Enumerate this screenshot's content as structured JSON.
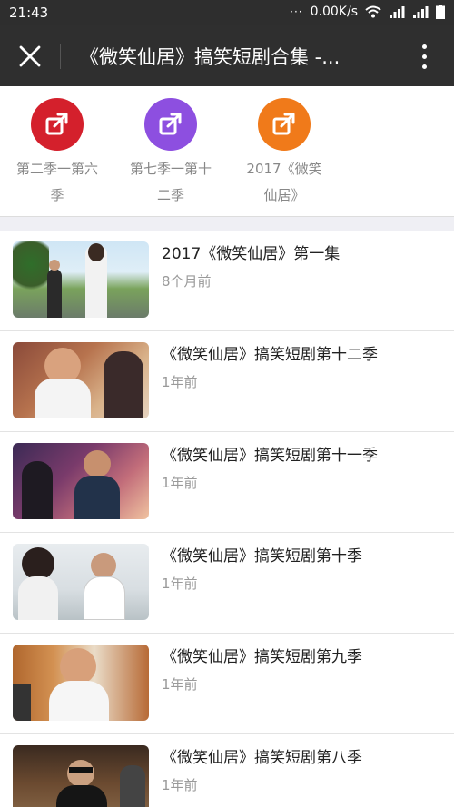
{
  "status_bar": {
    "time": "21:43",
    "dots": "···",
    "net_speed": "0.00K/s",
    "icons": [
      "wifi-icon",
      "signal-icon",
      "signal-icon",
      "battery-icon"
    ]
  },
  "header": {
    "close_icon": "close-icon",
    "title": "《微笑仙居》搞笑短剧合集 -...",
    "menu_icon": "more-vertical-icon"
  },
  "shortcuts": [
    {
      "label_line1": "第二季一第六",
      "label_line2": "季",
      "color": "#d4202c",
      "icon": "share-icon"
    },
    {
      "label_line1": "第七季一第十",
      "label_line2": "二季",
      "color": "#8d4fe0",
      "icon": "share-icon"
    },
    {
      "label_line1": "2017《微笑",
      "label_line2": "仙居》",
      "color": "#f07a1a",
      "icon": "share-icon"
    }
  ],
  "videos": [
    {
      "title": "2017《微笑仙居》第一集",
      "time": "8个月前"
    },
    {
      "title": "《微笑仙居》搞笑短剧第十二季",
      "time": "1年前"
    },
    {
      "title": "《微笑仙居》搞笑短剧第十一季",
      "time": "1年前"
    },
    {
      "title": "《微笑仙居》搞笑短剧第十季",
      "time": "1年前"
    },
    {
      "title": "《微笑仙居》搞笑短剧第九季",
      "time": "1年前"
    },
    {
      "title": "《微笑仙居》搞笑短剧第八季",
      "time": "1年前"
    }
  ]
}
